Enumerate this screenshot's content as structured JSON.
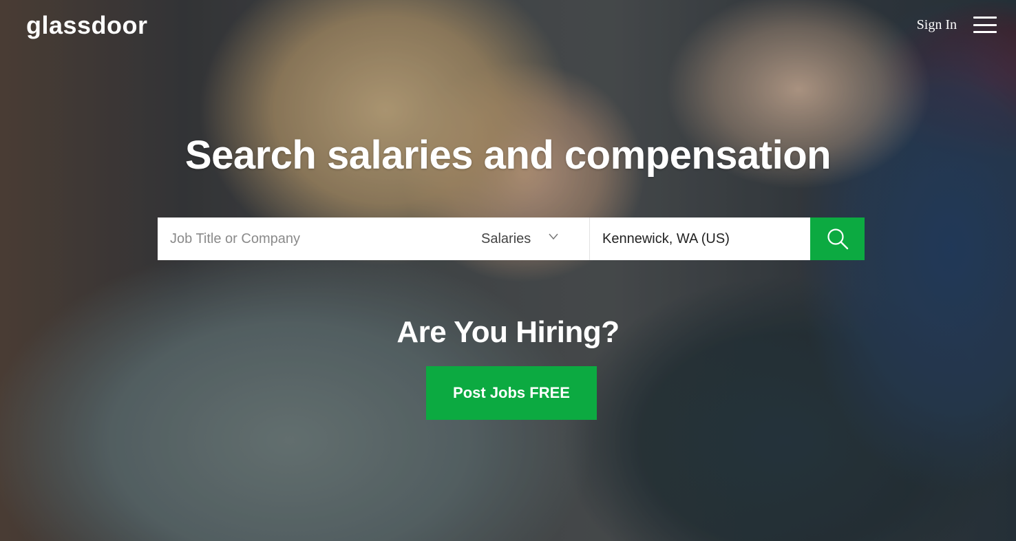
{
  "header": {
    "logo_text": "glassdoor",
    "sign_in_label": "Sign In",
    "menu_icon": "hamburger-menu-icon"
  },
  "hero": {
    "headline": "Search salaries and compensation"
  },
  "search": {
    "keyword_placeholder": "Job Title or Company",
    "keyword_value": "",
    "type_selected": "Salaries",
    "type_chevron_icon": "chevron-down-icon",
    "location_value": "Kennewick, WA (US)",
    "search_icon": "search-icon"
  },
  "hiring": {
    "heading": "Are You Hiring?",
    "post_jobs_label": "Post Jobs FREE"
  },
  "colors": {
    "brand_green": "#0caa41",
    "text_white": "#ffffff"
  }
}
